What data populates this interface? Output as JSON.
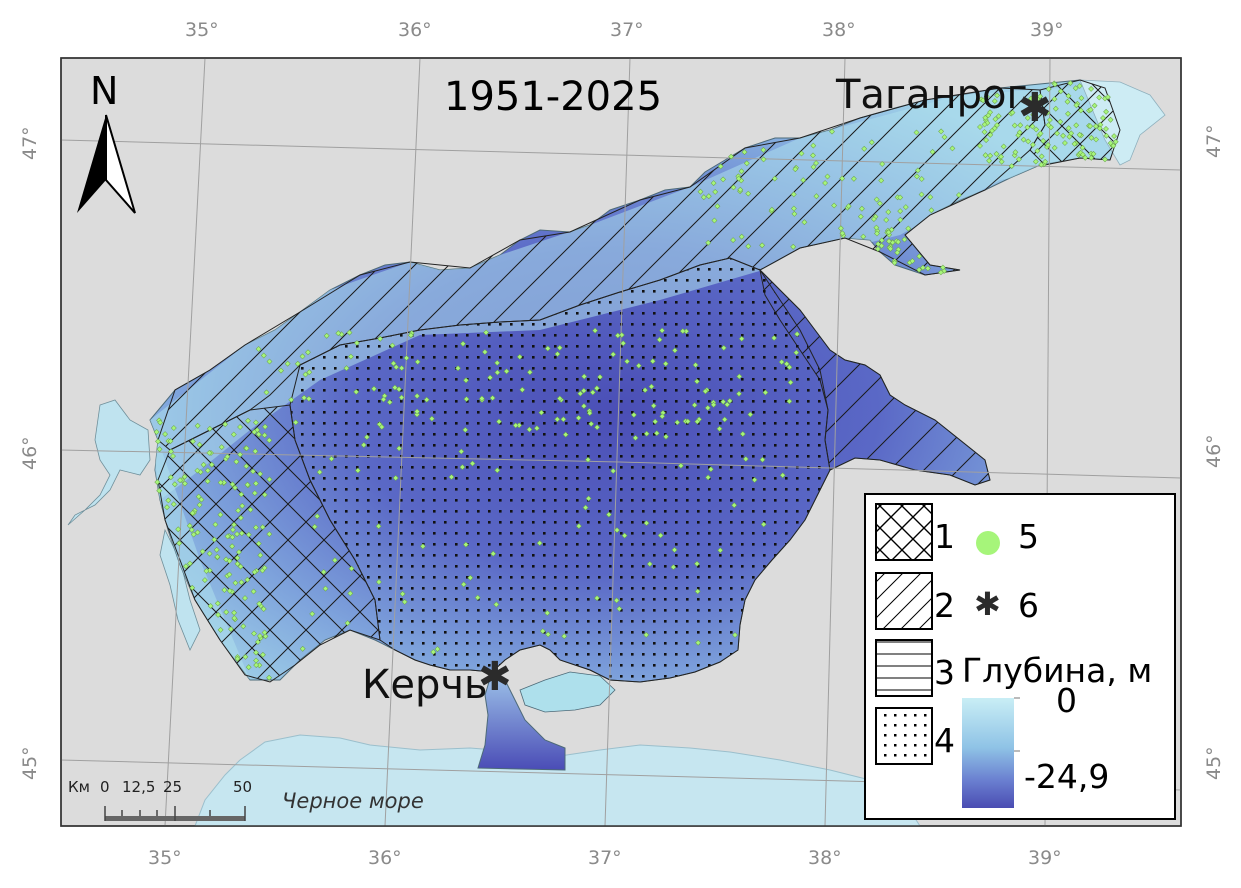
{
  "map": {
    "title": "1951-2025",
    "north_label": "N",
    "sea_label": "Черное море",
    "cities": [
      {
        "name": "Таганрог",
        "symbol": "star"
      },
      {
        "name": "Керчь",
        "symbol": "star"
      }
    ],
    "longitude_ticks_top": [
      "35°",
      "36°",
      "37°",
      "38°",
      "39°"
    ],
    "longitude_ticks_bottom": [
      "35°",
      "36°",
      "37°",
      "38°",
      "39°"
    ],
    "latitude_ticks_left": [
      "47°",
      "46°",
      "45°"
    ],
    "latitude_ticks_right": [
      "47°",
      "46°",
      "45°"
    ],
    "scale_bar": {
      "unit": "Км",
      "labels": [
        "0",
        "12,5",
        "25",
        "50"
      ]
    },
    "colors": {
      "land": "#dcdcdc",
      "shallow_water": "#c6e6f0",
      "deep_water": "#4a52b8",
      "observation_point": "#a6f57a",
      "station": "#2b2b2b"
    }
  },
  "legend": {
    "items": [
      {
        "number": "1",
        "pattern": "cross-hatch"
      },
      {
        "number": "2",
        "pattern": "diagonal-hatch"
      },
      {
        "number": "3",
        "pattern": "horizontal-lines"
      },
      {
        "number": "4",
        "pattern": "dots"
      },
      {
        "number": "5",
        "symbol": "green-circle"
      },
      {
        "number": "6",
        "symbol": "star"
      }
    ],
    "depth_title": "Глубина, м",
    "depth_max": "0",
    "depth_min": "-24,9"
  }
}
